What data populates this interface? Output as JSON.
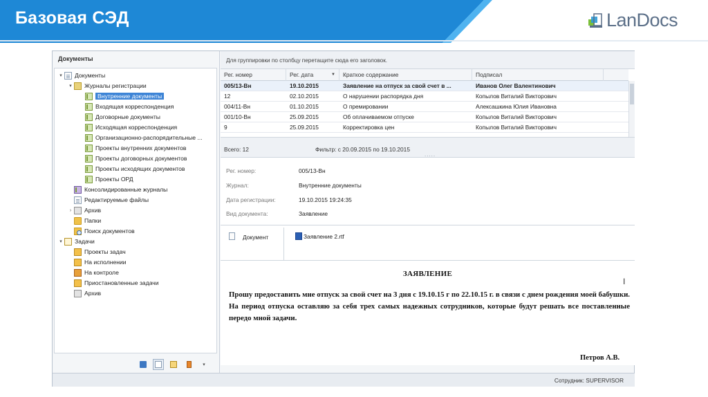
{
  "slide": {
    "title": "Базовая СЭД",
    "logo_text": "LanDocs",
    "banner_color": "#1e88d6",
    "banner_accent": "#4fb3f0"
  },
  "left_panel": {
    "header": "Документы",
    "tree": [
      {
        "label": "Документы",
        "icon": "docs-folder-icon",
        "expander": "▾"
      },
      {
        "label": "Журналы регистрации",
        "icon": "folder-icon",
        "expander": "▾"
      },
      {
        "label": "Внутренние документы",
        "icon": "journal-icon",
        "selected": true
      },
      {
        "label": "Входящая корреспонденция",
        "icon": "journal-icon"
      },
      {
        "label": "Договорные документы",
        "icon": "journal-icon"
      },
      {
        "label": "Исходящая корреспонденция",
        "icon": "journal-icon"
      },
      {
        "label": "Организационно-распорядительные ...",
        "icon": "journal-icon"
      },
      {
        "label": "Проекты внутренних документов",
        "icon": "journal-icon"
      },
      {
        "label": "Проекты договорных документов",
        "icon": "journal-icon"
      },
      {
        "label": "Проекты исходящих документов",
        "icon": "journal-icon"
      },
      {
        "label": "Проекты ОРД",
        "icon": "journal-icon"
      },
      {
        "label": "Консолидированные журналы",
        "icon": "consolidated-journal-icon"
      },
      {
        "label": "Редактируемые файлы",
        "icon": "edited-files-icon"
      },
      {
        "label": "Архив",
        "icon": "archive-icon",
        "expander": "›"
      },
      {
        "label": "Папки",
        "icon": "folder-icon"
      },
      {
        "label": "Поиск документов",
        "icon": "search-folder-icon"
      },
      {
        "label": "Задачи",
        "icon": "tasks-icon",
        "expander": "▾"
      },
      {
        "label": "Проекты задач",
        "icon": "task-icon"
      },
      {
        "label": "На исполнении",
        "icon": "task-icon"
      },
      {
        "label": "На контроле",
        "icon": "task-icon"
      },
      {
        "label": "Приостановленные задачи",
        "icon": "task-icon"
      },
      {
        "label": "Архив",
        "icon": "archive-icon"
      }
    ],
    "toolbar": [
      "documents-view-icon",
      "journal-view-icon",
      "tasks-view-icon",
      "book-view-icon",
      "dropdown-arrow-icon"
    ]
  },
  "grid": {
    "group_hint": "Для группировки по столбцу перетащите сюда его заголовок.",
    "columns": [
      "Рег. номер",
      "Рег. дата",
      "Краткое содержание",
      "Подписал"
    ],
    "sort_indicator": "▼",
    "rows": [
      {
        "num": "005/13-Вн",
        "date": "19.10.2015",
        "summary": "Заявление на отпуск за свой счет в ...",
        "signer": "Иванов Олег Валентинович",
        "selected": true
      },
      {
        "num": "12",
        "date": "02.10.2015",
        "summary": "О нарушении распорядка дня",
        "signer": "Копылов Виталий Викторович"
      },
      {
        "num": "004/11-Вн",
        "date": "01.10.2015",
        "summary": "О премировании",
        "signer": "Алексашкина Юлия Ивановна"
      },
      {
        "num": "001/10-Вн",
        "date": "25.09.2015",
        "summary": "Об оплачиваемом отпуске",
        "signer": "Копылов Виталий Викторович"
      },
      {
        "num": "9",
        "date": "25.09.2015",
        "summary": "Корректировка цен",
        "signer": "Копылов Виталий Викторович"
      }
    ],
    "total": "Всего: 12",
    "filter": "Фильтр: с 20.09.2015 по 19.10.2015",
    "splitter": "....."
  },
  "details": {
    "fields": [
      {
        "label": "Рег. номер:",
        "value": "005/13-Вн"
      },
      {
        "label": "Журнал:",
        "value": "Внутренние документы"
      },
      {
        "label": "Дата регистрации:",
        "value": "19.10.2015 19:24:35"
      },
      {
        "label": "Вид документа:",
        "value": "Заявление"
      }
    ],
    "attachment_label": "Документ",
    "attachment_file": "Заявление 2.rtf"
  },
  "preview": {
    "title": "ЗАЯВЛЕНИЕ",
    "body": "Прошу предоставить мне отпуск за свой счет на 3 дня с 19.10.15 г по 22.10.15 г. в связи с днем рождения моей бабушки. На период отпуска оставляю за себя трех самых надежных сотрудников, которые будут решать все поставленные передо мной задачи.",
    "signature": "Петров А.В.",
    "cursor": "I"
  },
  "status_bar": {
    "employee": "Сотрудник: SUPERVISOR"
  }
}
